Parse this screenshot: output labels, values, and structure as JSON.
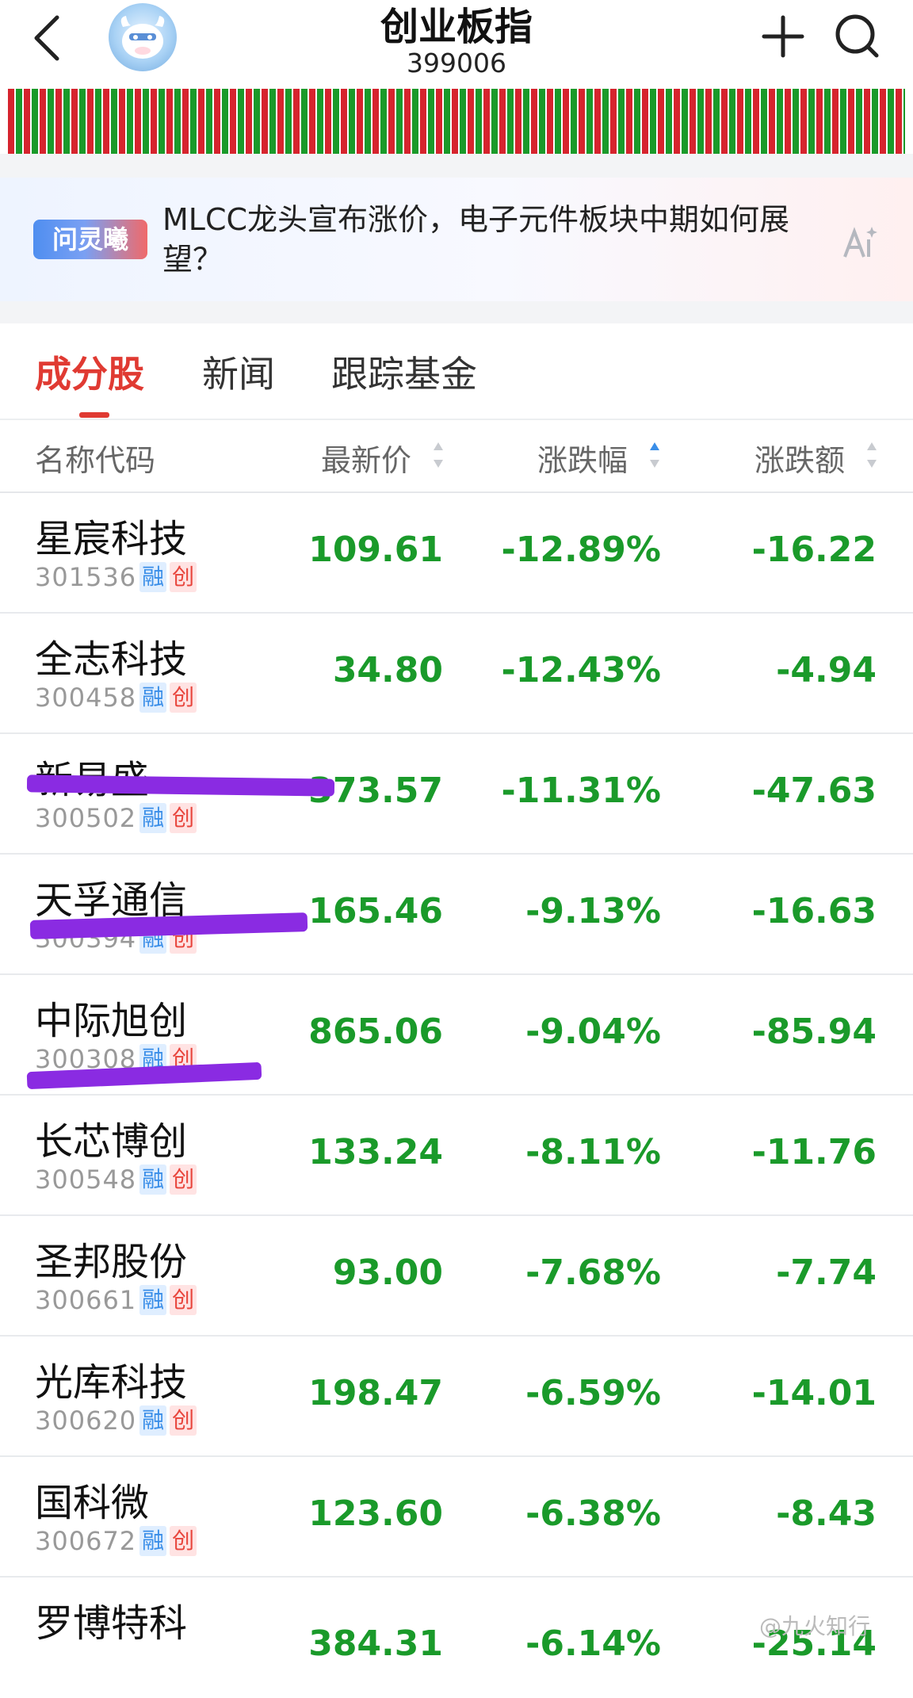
{
  "header": {
    "title": "创业板指",
    "code": "399006"
  },
  "ai_banner": {
    "badge": "问灵曦",
    "text": "MLCC龙头宣布涨价，电子元件板块中期如何展望？"
  },
  "tabs": [
    {
      "label": "成分股",
      "active": true
    },
    {
      "label": "新闻",
      "active": false
    },
    {
      "label": "跟踪基金",
      "active": false
    }
  ],
  "columns": {
    "name": "名称代码",
    "price": "最新价",
    "pct": "涨跌幅",
    "chg": "涨跌额"
  },
  "tags": {
    "rong": "融",
    "chuang": "创"
  },
  "rows": [
    {
      "name": "星宸科技",
      "code": "301536",
      "price": "109.61",
      "pct": "-12.89%",
      "chg": "-16.22"
    },
    {
      "name": "全志科技",
      "code": "300458",
      "price": "34.80",
      "pct": "-12.43%",
      "chg": "-4.94"
    },
    {
      "name": "新易盛",
      "code": "300502",
      "price": "373.57",
      "pct": "-11.31%",
      "chg": "-47.63"
    },
    {
      "name": "天孚通信",
      "code": "300394",
      "price": "165.46",
      "pct": "-9.13%",
      "chg": "-16.63"
    },
    {
      "name": "中际旭创",
      "code": "300308",
      "price": "865.06",
      "pct": "-9.04%",
      "chg": "-85.94"
    },
    {
      "name": "长芯博创",
      "code": "300548",
      "price": "133.24",
      "pct": "-8.11%",
      "chg": "-11.76"
    },
    {
      "name": "圣邦股份",
      "code": "300661",
      "price": "93.00",
      "pct": "-7.68%",
      "chg": "-7.74"
    },
    {
      "name": "光库科技",
      "code": "300620",
      "price": "198.47",
      "pct": "-6.59%",
      "chg": "-14.01"
    },
    {
      "name": "国科微",
      "code": "300672",
      "price": "123.60",
      "pct": "-6.38%",
      "chg": "-8.43"
    },
    {
      "name": "罗博特科",
      "code": "",
      "price": "384.31",
      "pct": "-6.14%",
      "chg": "-25.14"
    }
  ],
  "watermark": "@九火知行",
  "colors": {
    "down": "#1a9a2a",
    "up": "#d6242e",
    "accent": "#e03a32"
  },
  "icons": [
    "back-arrow-icon",
    "avatar-icon",
    "plus-icon",
    "search-icon",
    "ai-icon",
    "sort-icon"
  ]
}
